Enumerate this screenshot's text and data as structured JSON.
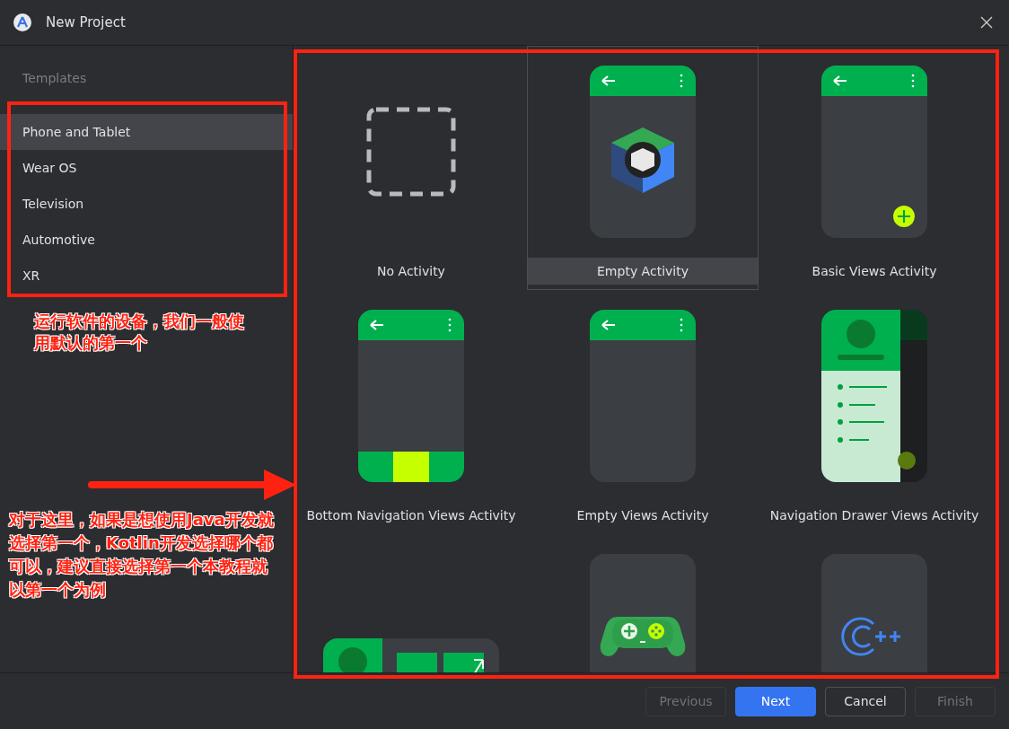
{
  "window": {
    "title": "New Project"
  },
  "sidebar": {
    "heading": "Templates",
    "items": [
      {
        "label": "Phone and Tablet",
        "selected": true
      },
      {
        "label": "Wear OS",
        "selected": false
      },
      {
        "label": "Television",
        "selected": false
      },
      {
        "label": "Automotive",
        "selected": false
      },
      {
        "label": "XR",
        "selected": false
      }
    ]
  },
  "templates": [
    {
      "kind": "no_activity",
      "label": "No Activity",
      "selected": false
    },
    {
      "kind": "empty_compose",
      "label": "Empty Activity",
      "selected": true
    },
    {
      "kind": "basic_views",
      "label": "Basic Views Activity",
      "selected": false
    },
    {
      "kind": "bottom_nav",
      "label": "Bottom Navigation Views Activity",
      "selected": false
    },
    {
      "kind": "empty_views",
      "label": "Empty Views Activity",
      "selected": false
    },
    {
      "kind": "nav_drawer",
      "label": "Navigation Drawer Views Activity",
      "selected": false
    },
    {
      "kind": "responsive",
      "selected": false
    },
    {
      "kind": "game",
      "selected": false
    },
    {
      "kind": "native_cpp",
      "selected": false
    }
  ],
  "buttons": [
    {
      "label": "Previous",
      "disabled": true,
      "primary": false
    },
    {
      "label": "Next",
      "disabled": false,
      "primary": true
    },
    {
      "label": "Cancel",
      "disabled": false,
      "primary": false
    },
    {
      "label": "Finish",
      "disabled": true,
      "primary": false
    }
  ],
  "annotation_notes": [
    "运行软件的设备，我们一般使用默认的第一个",
    "对于这里，如果是想使用Java开发就选择第一个，Kotlin开发选择哪个都可以，建议直接选择第一个本教程就以第一个为例"
  ]
}
